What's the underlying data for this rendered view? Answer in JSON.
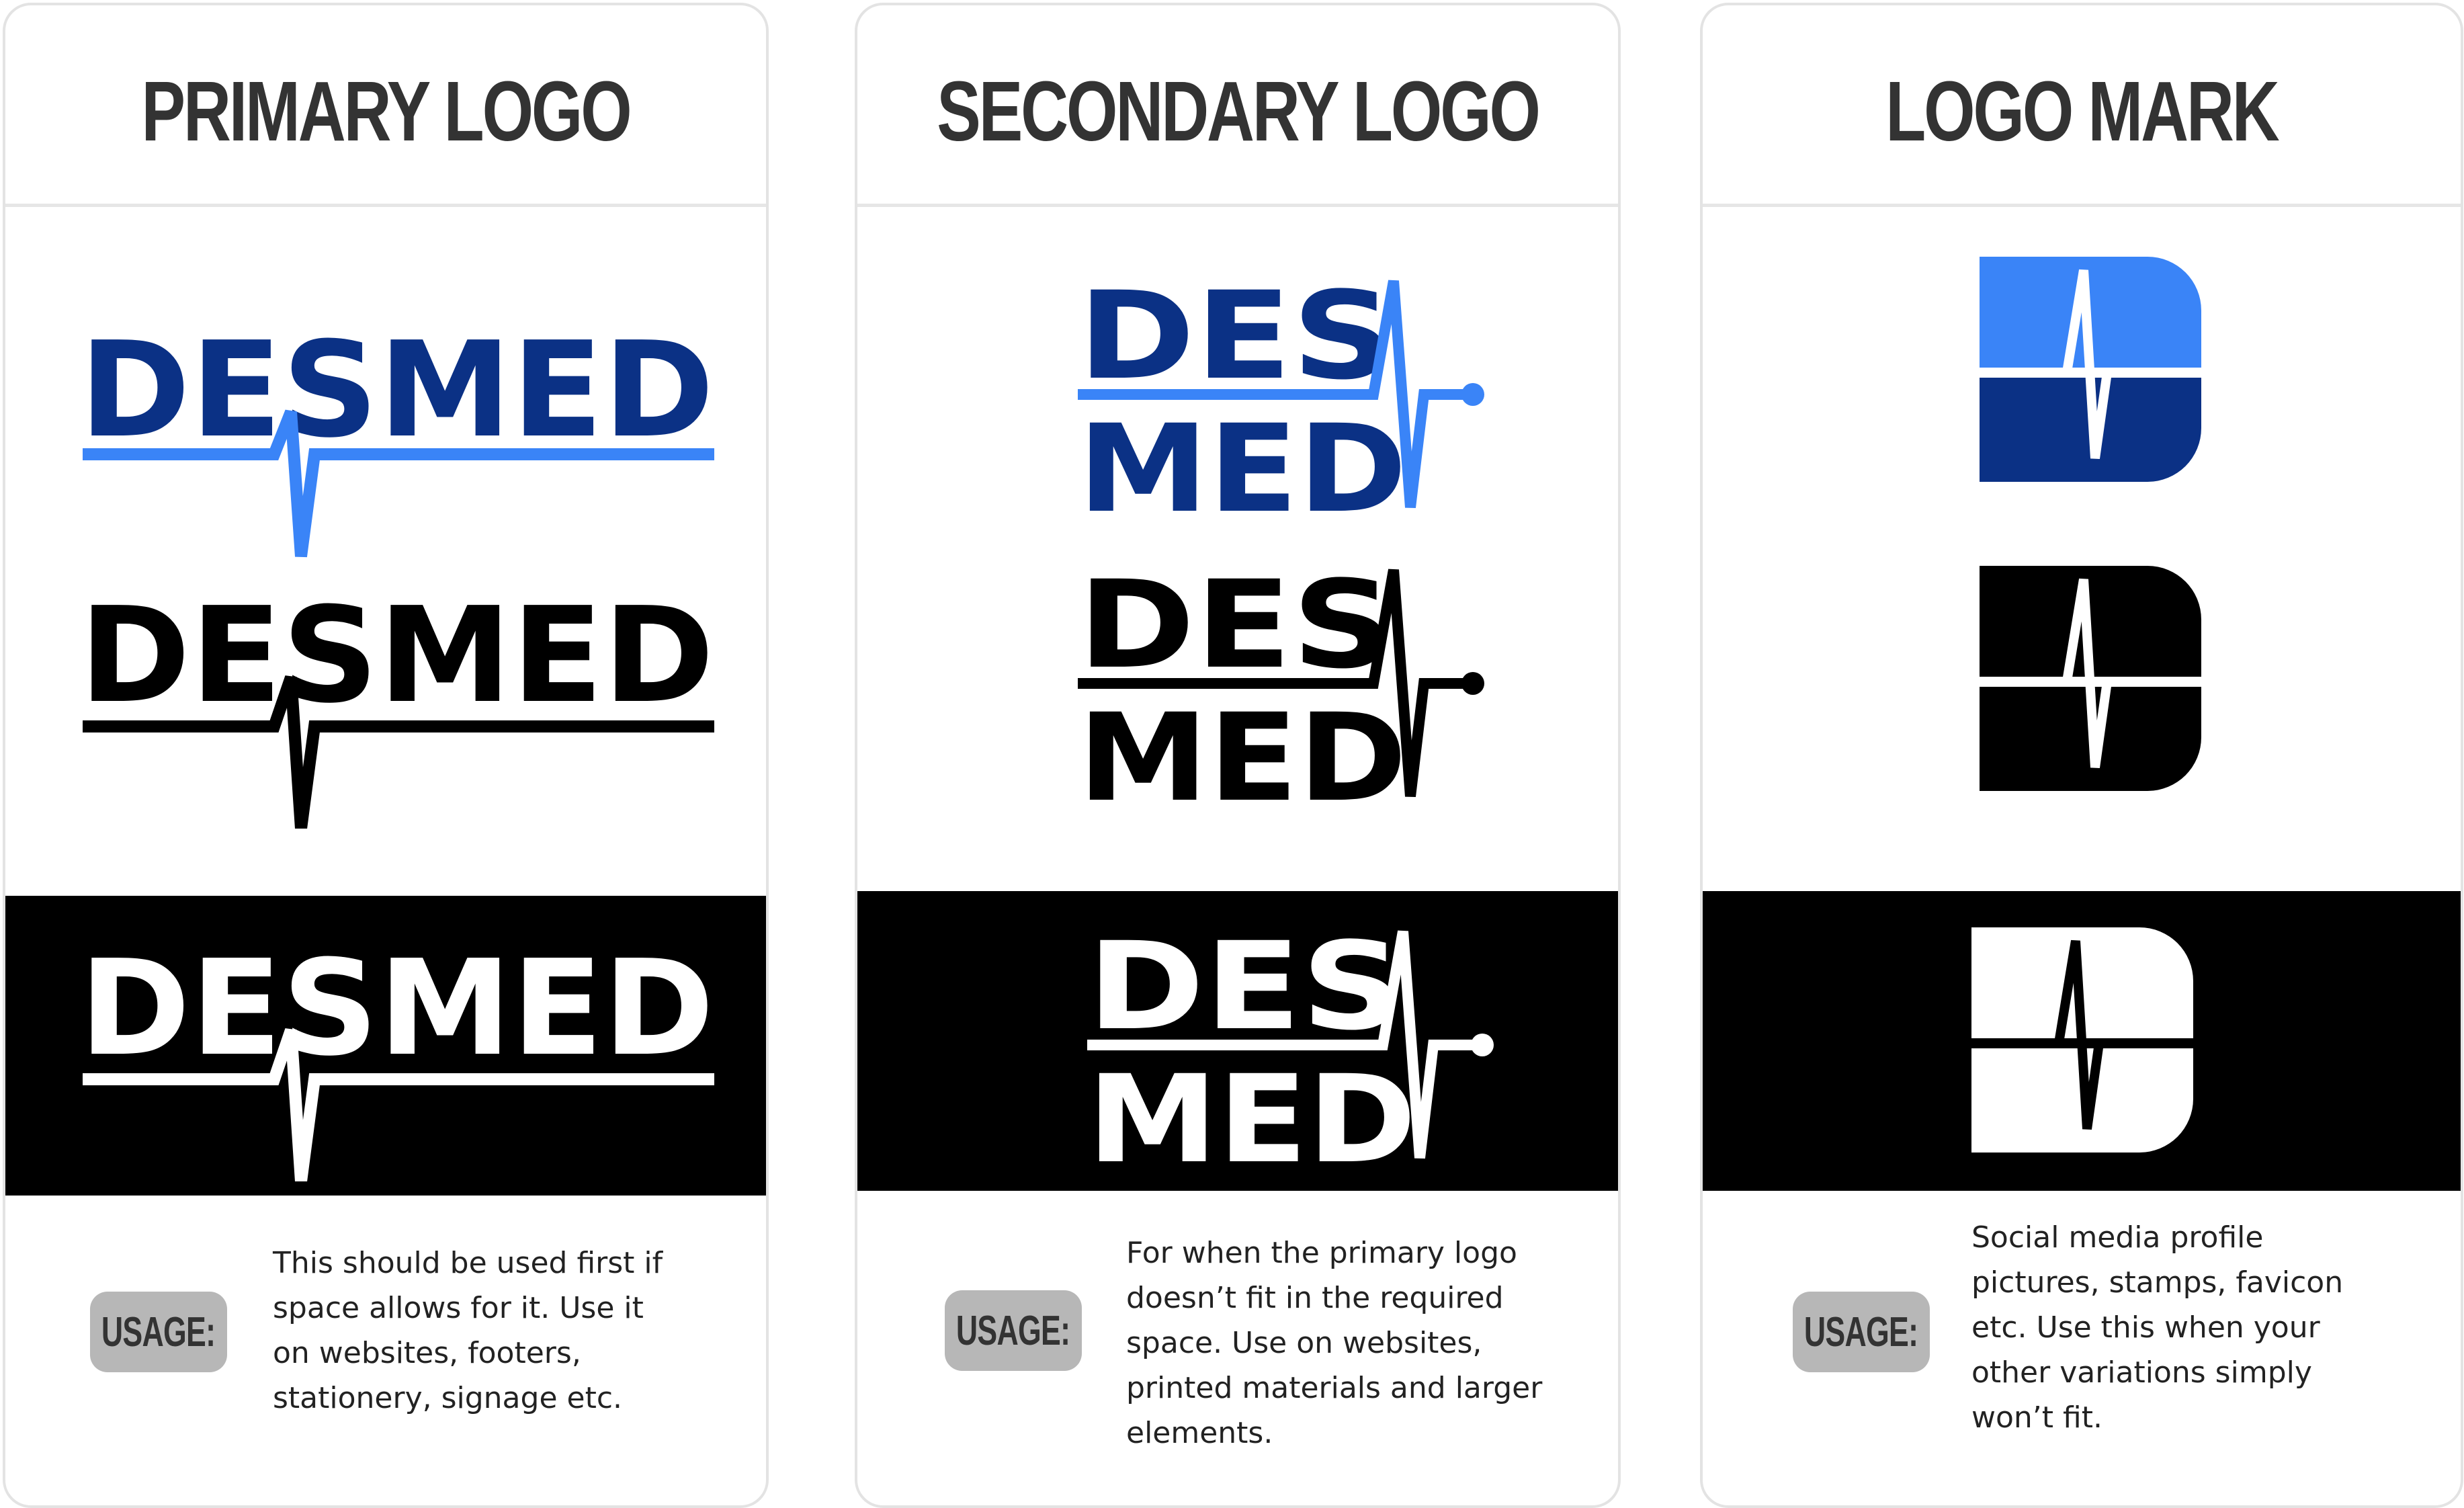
{
  "colors": {
    "navy": "#0b3185",
    "blue": "#3a84f7",
    "black": "#000000",
    "white": "#ffffff",
    "badge": "#b7b7b7",
    "title_text": "#333333"
  },
  "wordmark": {
    "top": "DES",
    "bottom": "MED",
    "full": "DESMED"
  },
  "columns": [
    {
      "title": "PRIMARY LOGO",
      "usage_label": "USAGE:",
      "usage_lines": [
        "This should be used first if",
        "space allows for it. Use it",
        "on websites, footers,",
        "stationery, signage etc."
      ]
    },
    {
      "title": "SECONDARY LOGO",
      "usage_label": "USAGE:",
      "usage_lines": [
        "For when the primary logo",
        "doesn’t fit in the required",
        "space. Use on websites,",
        "printed materials and larger",
        "elements."
      ]
    },
    {
      "title": "LOGO MARK",
      "usage_label": "USAGE:",
      "usage_lines": [
        "Social media profile",
        "pictures, stamps, favicon",
        "etc. Use this when your",
        "other variations simply",
        "won’t fit."
      ]
    }
  ]
}
